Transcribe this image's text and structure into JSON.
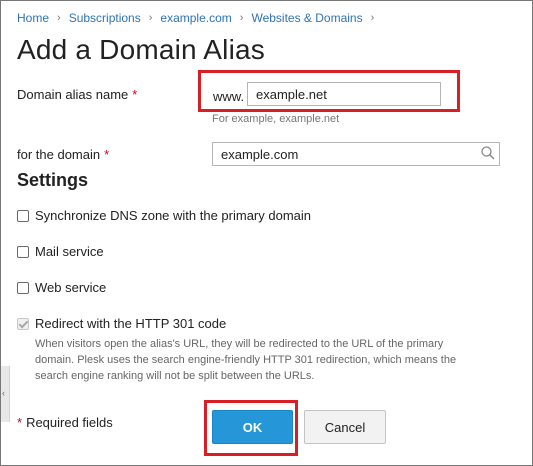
{
  "breadcrumb": [
    "Home",
    "Subscriptions",
    "example.com",
    "Websites & Domains"
  ],
  "breadcrumb_separator": "›",
  "page_title": "Add a Domain Alias",
  "form": {
    "alias_label": "Domain alias name",
    "required_mark": "*",
    "alias_prefix": "www.",
    "alias_value": "example.net",
    "alias_hint": "For example, example.net",
    "domain_label": "for the domain",
    "domain_value": "example.com"
  },
  "settings": {
    "heading": "Settings",
    "options": [
      {
        "label": "Synchronize DNS zone with the primary domain",
        "checked": false,
        "disabled": false
      },
      {
        "label": "Mail service",
        "checked": false,
        "disabled": false
      },
      {
        "label": "Web service",
        "checked": false,
        "disabled": false
      },
      {
        "label": "Redirect with the HTTP 301 code",
        "checked": true,
        "disabled": true
      }
    ],
    "redirect_description": "When visitors open the alias's URL, they will be redirected to the URL of the primary domain. Plesk uses the search engine-friendly HTTP 301 redirection, which means the search engine ranking will not be split between the URLs."
  },
  "footer": {
    "required_star": "*",
    "required_text": "Required fields",
    "ok_label": "OK",
    "cancel_label": "Cancel"
  },
  "colors": {
    "link": "#2e73b8",
    "required": "#d0021b",
    "highlight": "#d81f26",
    "primary_button": "#2596d8"
  },
  "icons": {
    "search": "search-icon",
    "side_tab": "chevron-left-icon"
  }
}
